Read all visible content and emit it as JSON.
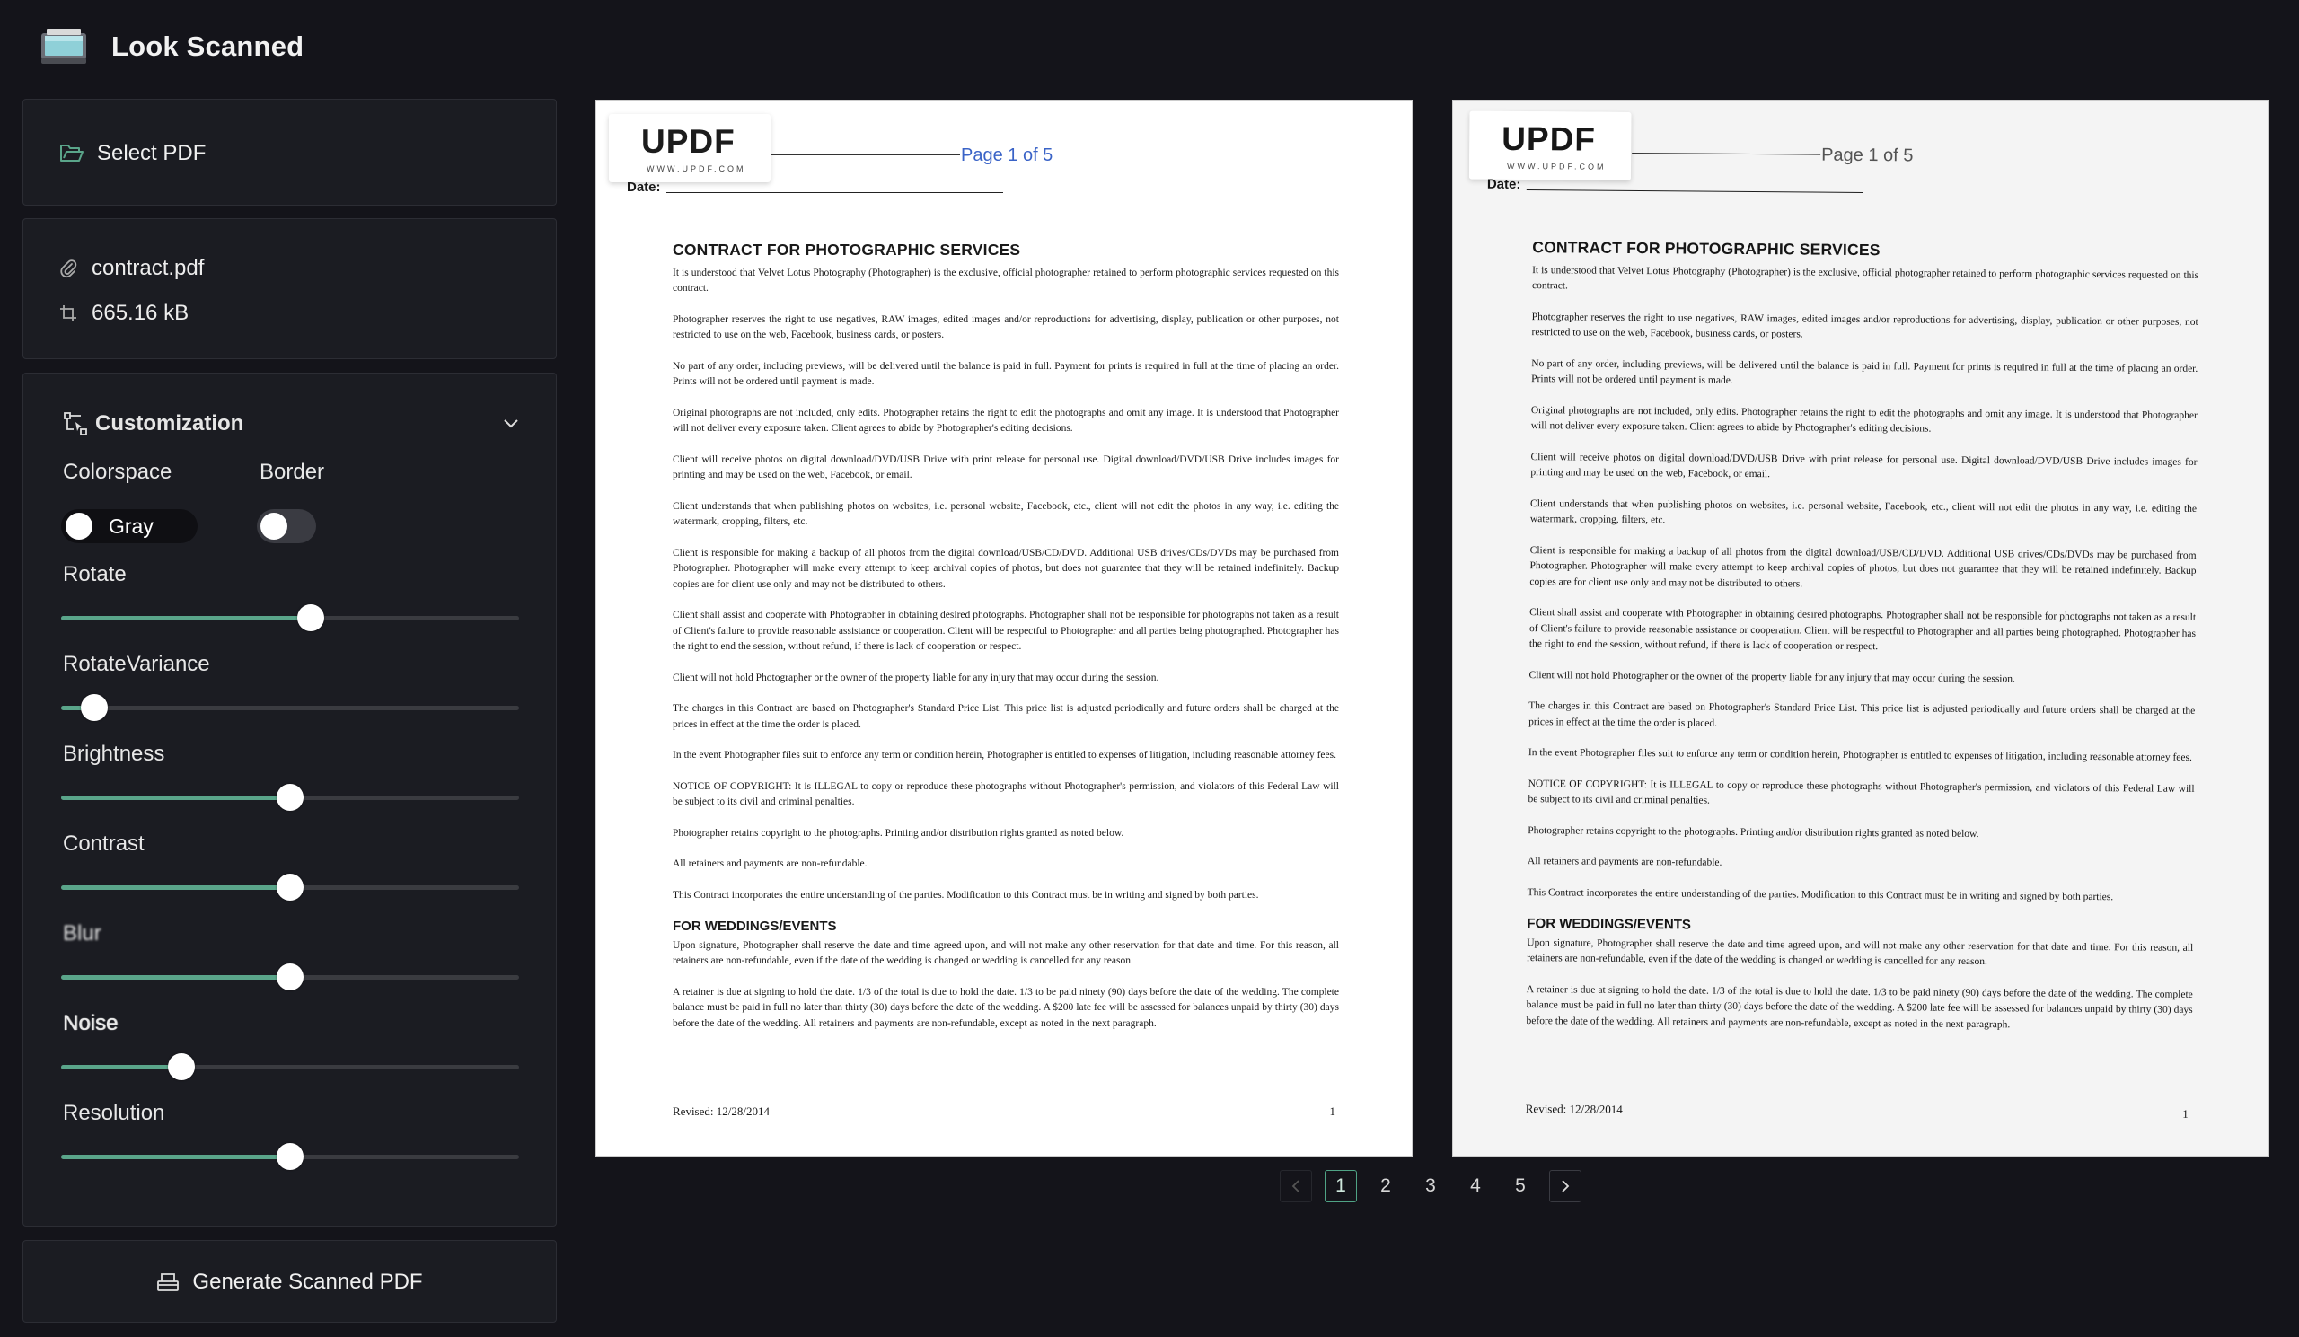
{
  "app": {
    "title": "Look Scanned",
    "logo_icon": "scanner-icon"
  },
  "sidebar": {
    "select_label": "Select PDF",
    "file": {
      "name": "contract.pdf",
      "size": "665.16 kB"
    },
    "customization": {
      "title": "Customization",
      "colorspace_label": "Colorspace",
      "colorspace_value": "Gray",
      "border_label": "Border",
      "border_on": false,
      "sliders": [
        {
          "label": "Rotate",
          "value": 0.545
        },
        {
          "label": "RotateVariance",
          "value": 0.073
        },
        {
          "label": "Brightness",
          "value": 0.5
        },
        {
          "label": "Contrast",
          "value": 0.5
        },
        {
          "label": "Blur",
          "value": 0.5
        },
        {
          "label": "Noise",
          "value": 0.262
        },
        {
          "label": "Resolution",
          "value": 0.5
        }
      ]
    },
    "generate_label": "Generate Scanned PDF"
  },
  "colors": {
    "accent": "#5aa58a",
    "background": "#14141a",
    "panel": "#1b1c22"
  },
  "preview": {
    "watermark": "UPDF",
    "watermark_url": "WWW.UPDF.COM",
    "page_indicator": "Page 1 of 5",
    "date_label": "Date:",
    "doc_title": "CONTRACT FOR PHOTOGRAPHIC SERVICES",
    "paragraphs": [
      "It is understood that Velvet Lotus Photography (Photographer) is the exclusive, official photographer retained to perform photographic services requested on this contract.",
      "Photographer reserves the right to use negatives, RAW images, edited images and/or reproductions for advertising, display, publication or other purposes, not restricted to use on the web, Facebook, business cards, or posters.",
      "No part of any order, including previews, will be delivered until the balance is paid in full. Payment for prints is required in full at the time of placing an order. Prints will not be ordered until payment is made.",
      "Original photographs are not included, only edits. Photographer retains the right to edit the photographs and omit any image. It is understood that Photographer will not deliver every exposure taken. Client agrees to abide by Photographer's editing decisions.",
      "Client will receive photos on digital download/DVD/USB Drive with print release for personal use. Digital download/DVD/USB Drive includes images for printing and may be used on the web, Facebook, or email.",
      "Client understands that when publishing photos on websites, i.e. personal website, Facebook, etc., client will not edit the photos in any way, i.e. editing the watermark, cropping, filters, etc.",
      "Client is responsible for making a backup of all photos from the digital download/USB/CD/DVD. Additional USB drives/CDs/DVDs may be purchased from Photographer. Photographer will make every attempt to keep archival copies of photos, but does not guarantee that they will be retained indefinitely. Backup copies are for client use only and may not be distributed to others.",
      "Client shall assist and cooperate with Photographer in obtaining desired photographs. Photographer shall not be responsible for photographs not taken as a result of Client's failure to provide reasonable assistance or cooperation. Client will be respectful to Photographer and all parties being photographed. Photographer has the right to end the session, without refund, if there is lack of cooperation or respect.",
      "Client will not hold Photographer or the owner of the property liable for any injury that may occur during the session.",
      "The charges in this Contract are based on Photographer's Standard Price List. This price list is adjusted periodically and future orders shall be charged at the prices in effect at the time the order is placed.",
      "In the event Photographer files suit to enforce any term or condition herein, Photographer is entitled to expenses of litigation, including reasonable attorney fees.",
      "NOTICE OF COPYRIGHT: It is ILLEGAL to copy or reproduce these photographs without Photographer's permission, and violators of this Federal Law will be subject to its civil and criminal penalties.",
      "Photographer retains copyright to the photographs. Printing and/or distribution rights granted as noted below.",
      "All retainers and payments are non-refundable.",
      "This Contract incorporates the entire understanding of the parties. Modification to this Contract must be in writing and signed by both parties."
    ],
    "section_title": "FOR WEDDINGS/EVENTS",
    "section_paragraphs": [
      "Upon signature, Photographer shall reserve the date and time agreed upon, and will not make any other reservation for that date and time. For this reason, all retainers are non-refundable, even if the date of the wedding is changed or wedding is cancelled for any reason.",
      "A retainer is due at signing to hold the date. 1/3 of the total is due to hold the date. 1/3 to be paid ninety (90) days before the date of the wedding. The complete balance must be paid in full no later than thirty (30) days before the date of the wedding. A $200 late fee will be assessed for balances unpaid by thirty (30) days before the date of the wedding. All retainers and payments are non-refundable, except as noted in the next paragraph."
    ],
    "footer_left": "Revised: 12/28/2014",
    "footer_right": "1"
  },
  "pagination": {
    "pages": [
      "1",
      "2",
      "3",
      "4",
      "5"
    ],
    "current": "1"
  }
}
